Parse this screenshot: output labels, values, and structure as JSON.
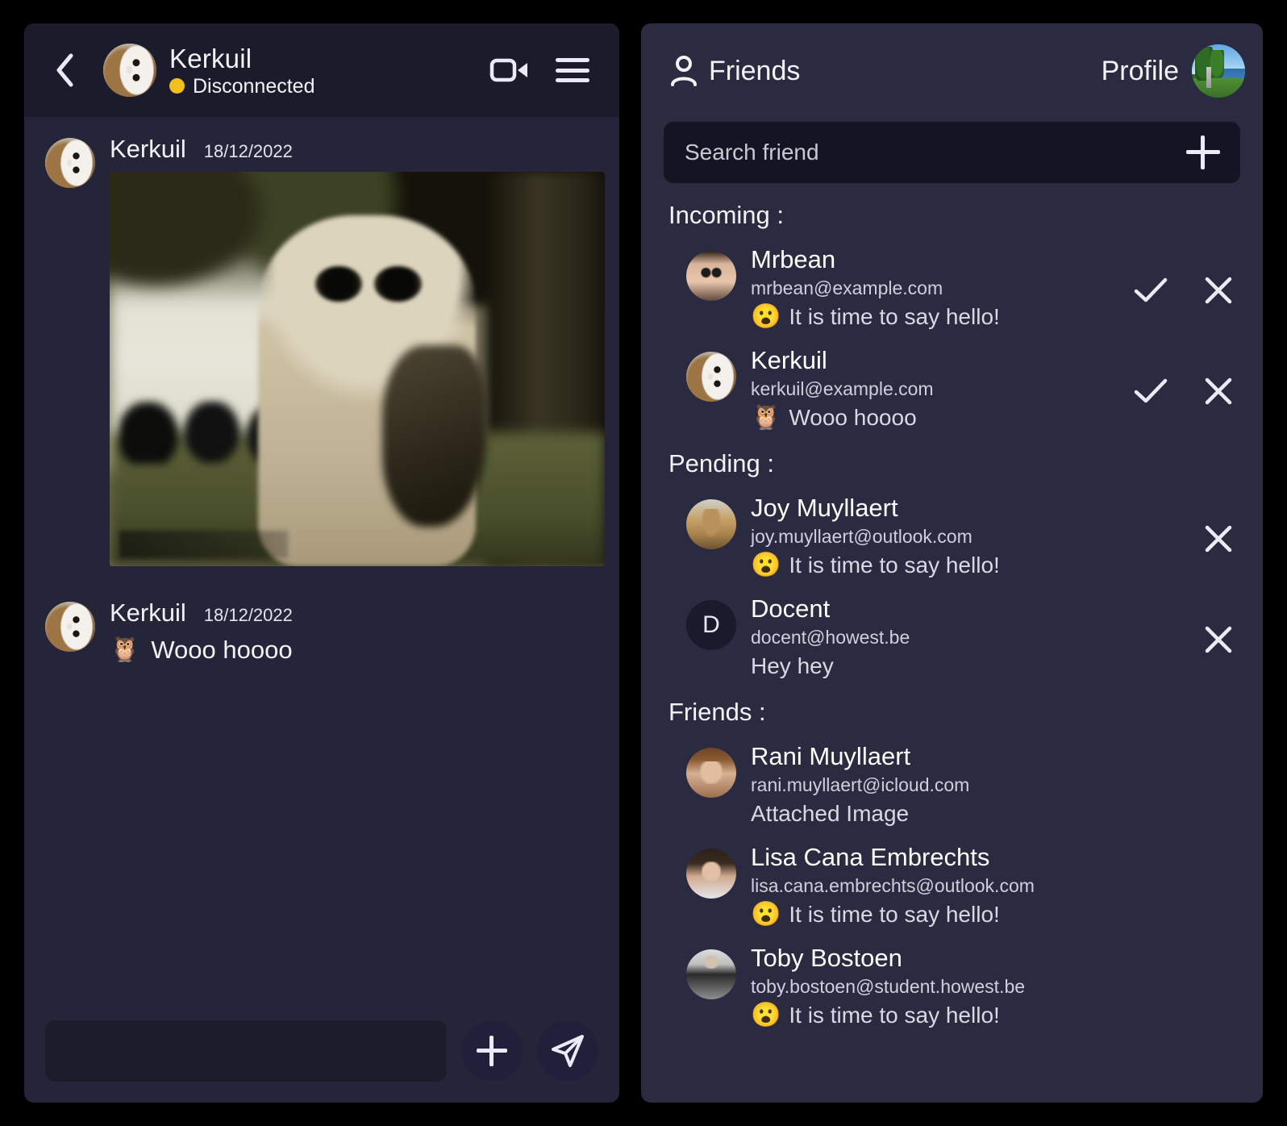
{
  "theme": {
    "page_background": "#000000",
    "panel_background": "#252539",
    "friends_panel_background": "#2a2a40",
    "header_background": "#1b1b2c",
    "search_background": "#151422",
    "text_primary": "#f2f2f7",
    "text_secondary": "#cfcfdd",
    "status_dot_color": "#f2c01e"
  },
  "chat": {
    "header": {
      "back_icon": "chevron-left-icon",
      "avatar": "kerkuil-owl-avatar",
      "name": "Kerkuil",
      "status": "Disconnected",
      "video_icon": "video-camera-icon",
      "menu_icon": "hamburger-menu-icon"
    },
    "messages": [
      {
        "author": "Kerkuil",
        "timestamp": "18/12/2022",
        "type": "image",
        "image_alt": "owlet-photo"
      },
      {
        "author": "Kerkuil",
        "timestamp": "18/12/2022",
        "type": "text",
        "emoji": "🦉",
        "text": "Wooo hoooo"
      }
    ],
    "composer": {
      "input_value": "",
      "input_placeholder": "",
      "attach_icon": "plus-icon",
      "send_icon": "send-paper-plane-icon"
    }
  },
  "friends": {
    "header": {
      "person_icon": "person-icon",
      "title": "Friends",
      "profile_label": "Profile",
      "profile_avatar": "minecraft-landscape-avatar"
    },
    "search": {
      "value": "",
      "placeholder": "Search friend",
      "add_icon": "plus-icon"
    },
    "sections": [
      {
        "title": "Incoming :",
        "key": "incoming",
        "items": [
          {
            "name": "Mrbean",
            "email": "mrbean@example.com",
            "emoji": "😮",
            "message": "It is time to say hello!",
            "avatar": "mrbean-photo-avatar",
            "avatar_kind": "photo",
            "accept": true,
            "decline": true
          },
          {
            "name": "Kerkuil",
            "email": "kerkuil@example.com",
            "emoji": "🦉",
            "message": "Wooo hoooo",
            "avatar": "kerkuil-owl-avatar",
            "avatar_kind": "owl",
            "accept": true,
            "decline": true
          }
        ]
      },
      {
        "title": "Pending :",
        "key": "pending",
        "items": [
          {
            "name": "Joy Muyllaert",
            "email": "joy.muyllaert@outlook.com",
            "emoji": "😮",
            "message": "It is time to say hello!",
            "avatar": "dog-photo-avatar",
            "avatar_kind": "dog",
            "accept": false,
            "decline": true
          },
          {
            "name": "Docent",
            "email": "docent@howest.be",
            "emoji": "",
            "message": "Hey hey",
            "avatar": "initial-avatar",
            "avatar_kind": "initial",
            "initial": "D",
            "accept": false,
            "decline": true
          }
        ]
      },
      {
        "title": "Friends :",
        "key": "friends",
        "items": [
          {
            "name": "Rani Muyllaert",
            "email": "rani.muyllaert@icloud.com",
            "emoji": "",
            "message": "Attached Image",
            "avatar": "rani-photo-avatar",
            "avatar_kind": "rani",
            "accept": false,
            "decline": false
          },
          {
            "name": "Lisa Cana Embrechts",
            "email": "lisa.cana.embrechts@outlook.com",
            "emoji": "😮",
            "message": "It is time to say hello!",
            "avatar": "lisa-photo-avatar",
            "avatar_kind": "lisa",
            "accept": false,
            "decline": false
          },
          {
            "name": "Toby Bostoen",
            "email": "toby.bostoen@student.howest.be",
            "emoji": "😮",
            "message": "It is time to say hello!",
            "avatar": "toby-photo-avatar",
            "avatar_kind": "toby",
            "accept": false,
            "decline": false,
            "clipped": true
          }
        ]
      }
    ]
  }
}
